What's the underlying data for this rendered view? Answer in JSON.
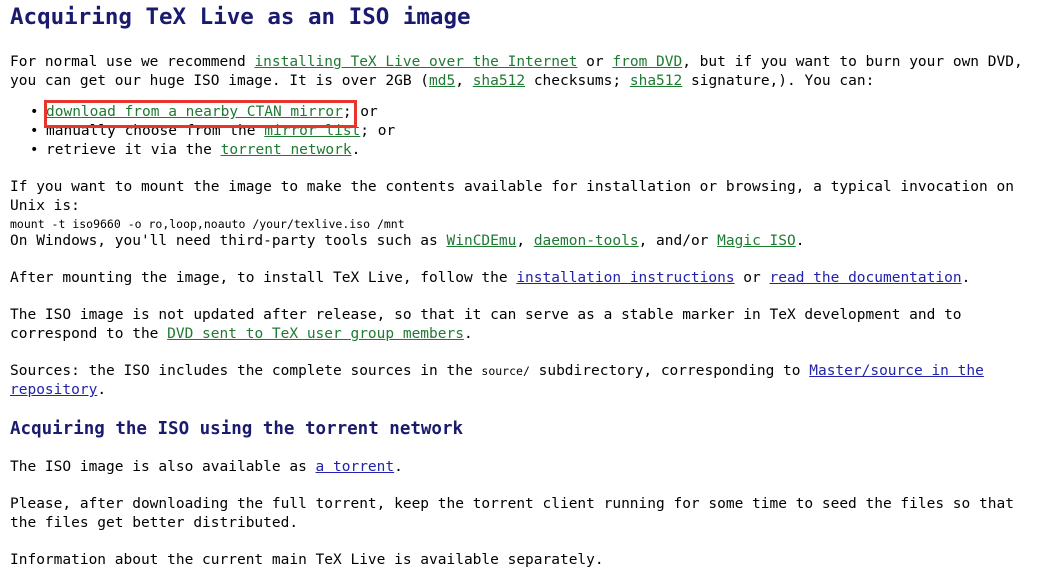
{
  "page": {
    "title": "Acquiring TeX Live as an ISO image",
    "subtitle": "Acquiring the ISO using the torrent network"
  },
  "intro": {
    "line1_a": "For normal use we recommend ",
    "link_install": "installing TeX Live over the Internet",
    "line1_b": " or ",
    "link_from_dvd": "from DVD",
    "line1_c": ", but if you want to burn your own DVD,",
    "line2_a": "you can get our huge ISO image. It is over 2GB (",
    "link_md5": "md5",
    "line2_b": ", ",
    "link_sha512_a": "sha512",
    "line2_c": " checksums; ",
    "link_sha512_b": "sha512",
    "line2_d": " signature,). You can:"
  },
  "bullets": [
    {
      "link": "download from a nearby CTAN mirror",
      "after": "; or",
      "before": "",
      "highlighted": true
    },
    {
      "before": "manually choose from the ",
      "link": "mirror list",
      "after": "; or",
      "highlighted": false
    },
    {
      "before": "retrieve it via the ",
      "link": "torrent network",
      "after": ".",
      "highlighted": false
    }
  ],
  "mount": {
    "line1": "If you want to mount the image to make the contents available for installation or browsing, a typical invocation on",
    "line2": "Unix is:",
    "command": "mount -t iso9660 -o ro,loop,noauto /your/texlive.iso /mnt",
    "windows_a": "On Windows, you'll need third-party tools such as ",
    "link_wincdemu": "WinCDEmu",
    "windows_b": ", ",
    "link_daemon_tools": "daemon-tools",
    "windows_c": ", and/or ",
    "link_magic_iso": "Magic ISO",
    "windows_d": "."
  },
  "after_mount": {
    "a": "After mounting the image, to install TeX Live, follow the ",
    "link_instructions": "installation instructions",
    "b": " or ",
    "link_documentation": "read the documentation",
    "c": "."
  },
  "stable": {
    "line1": "The ISO image is not updated after release, so that it can serve as a stable marker in TeX development and to",
    "line2_a": "correspond to the ",
    "link_dvd": "DVD sent to TeX user group members",
    "line2_b": "."
  },
  "sources": {
    "a": "Sources: the ISO includes the complete sources in the ",
    "code": "source/",
    "b": " subdirectory, corresponding to ",
    "link_repo_line1": "Master/source in the",
    "link_repo_line2": "repository",
    "c": "."
  },
  "torrent": {
    "line1_a": "The ISO image is also available as ",
    "link_torrent": "a torrent",
    "line1_b": ".",
    "line2": "Please, after downloading the full torrent, keep the torrent client running for some time to seed the files so that",
    "line3": "the files get better distributed.",
    "line4": "Information about the current main TeX Live is available separately."
  },
  "colors": {
    "heading": "#1a1a6e",
    "link_visited": "#1f7a32",
    "link_unvisited": "#2222aa",
    "highlight_box": "#e8342a",
    "text": "#000000",
    "background": "#ffffff"
  }
}
